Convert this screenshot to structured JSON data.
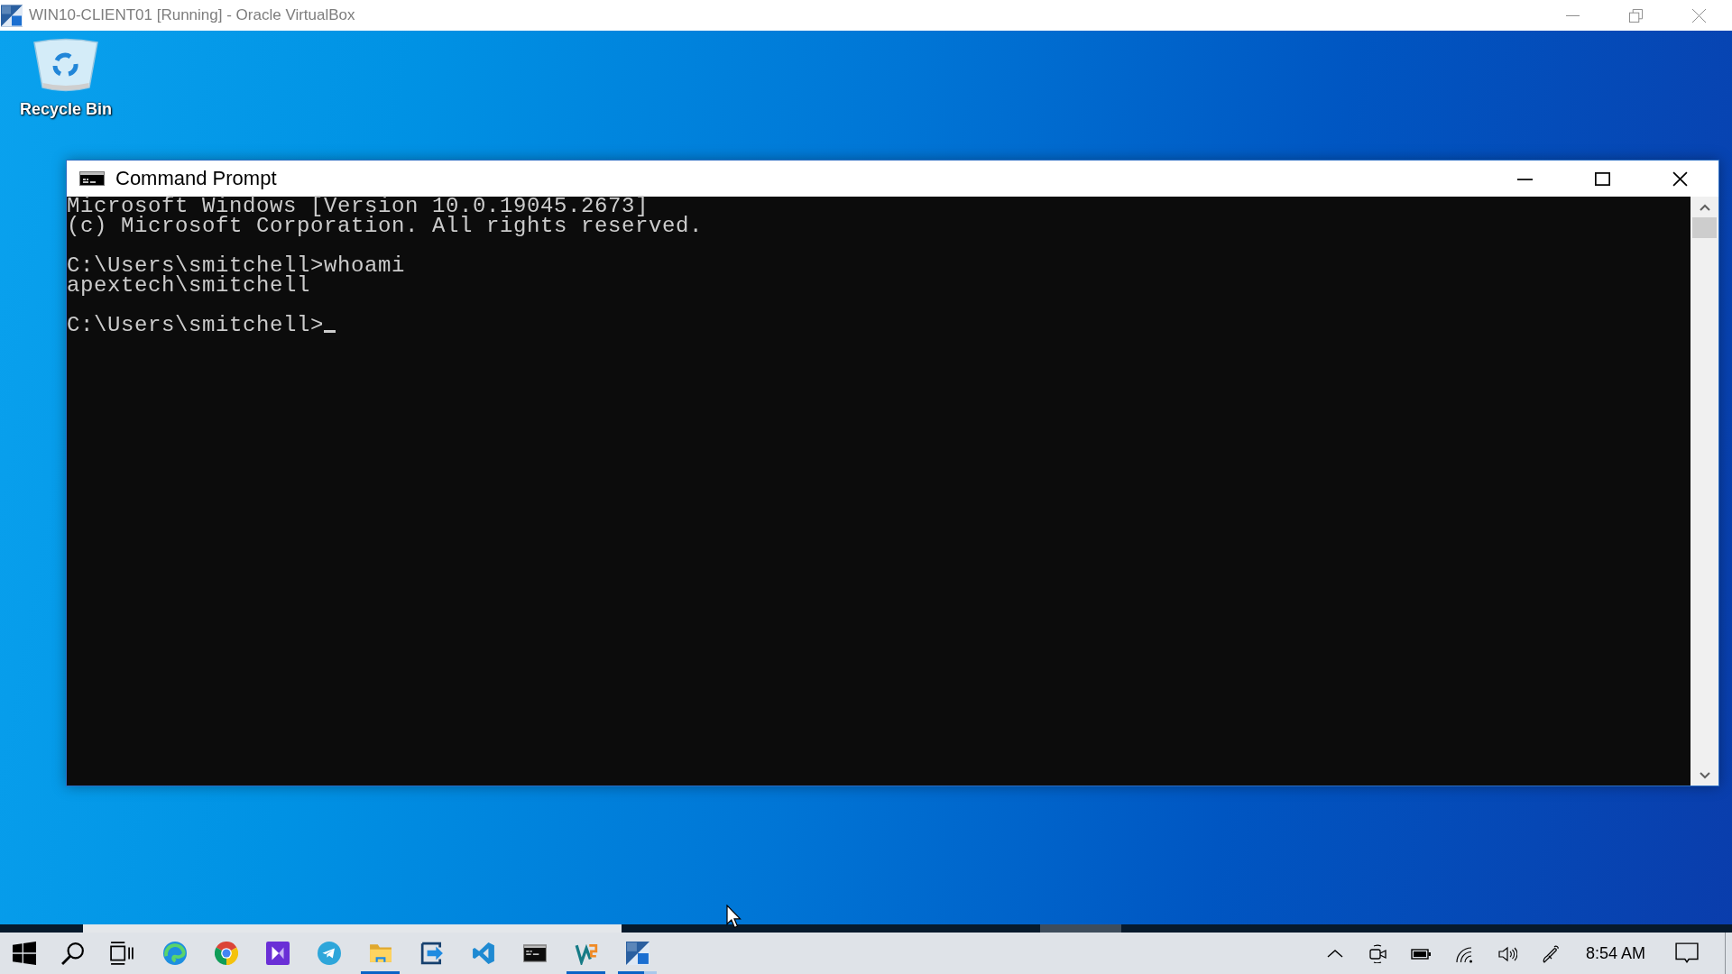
{
  "host_window": {
    "title": "WIN10-CLIENT01 [Running] - Oracle VirtualBox"
  },
  "desktop": {
    "icons": [
      {
        "label": "Recycle Bin"
      }
    ]
  },
  "command_prompt": {
    "title": "Command Prompt",
    "blocks": [
      [
        "Microsoft Windows [Version 10.0.19045.2673]",
        "(c) Microsoft Corporation. All rights reserved."
      ],
      [
        "C:\\Users\\smitchell>whoami",
        "apextech\\smitchell"
      ],
      [
        "C:\\Users\\smitchell>"
      ]
    ],
    "cursor": true
  },
  "taskbar": {
    "apps": [
      {
        "kind": "start",
        "running": false
      },
      {
        "kind": "search",
        "running": false
      },
      {
        "kind": "taskview",
        "running": false
      },
      {
        "kind": "swirl",
        "running": false
      },
      {
        "kind": "ring",
        "running": false
      },
      {
        "kind": "play",
        "running": false
      },
      {
        "kind": "plane",
        "running": false
      },
      {
        "kind": "folder",
        "running": true,
        "stacked": false
      },
      {
        "kind": "arrowbox",
        "running": false
      },
      {
        "kind": "ribbon",
        "running": false
      },
      {
        "kind": "console",
        "running": false
      },
      {
        "kind": "zigzag",
        "running": true,
        "stacked": false
      },
      {
        "kind": "tile",
        "running": true,
        "stacked": true
      }
    ],
    "clock": "8:54 AM"
  }
}
